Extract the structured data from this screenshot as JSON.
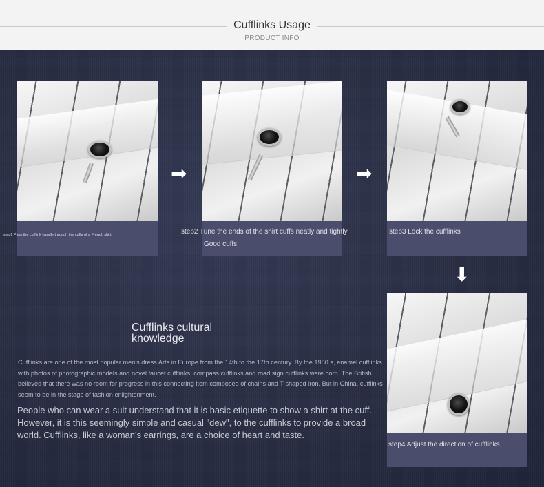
{
  "header": {
    "title": "Cufflinks Usage",
    "subtitle": "PRODUCT INFO"
  },
  "steps": [
    {
      "caption_lines": [
        "step1 Pass the cufflink handle through the cuffs of a French shirt"
      ]
    },
    {
      "caption_lines": [
        "step2 Tune the ends of the shirt cuffs neatly and tightly",
        "Good cuffs"
      ]
    },
    {
      "caption_lines": [
        "step3 Lock the cufflinks"
      ]
    },
    {
      "caption_lines": [
        "step4 Adjust the direction of cufflinks"
      ]
    }
  ],
  "arrows": {
    "right": "➡",
    "down": "⬇"
  },
  "culture": {
    "title_lines": [
      "Cufflinks cultural",
      "knowledge"
    ],
    "small_text": "Cufflinks are one of the most popular men's dress Arts in Europe from the 14th to the 17th century. By the 1950 s, enamel cufflinks with photos of photographic models and novel faucet cufflinks, compass cufflinks and road sign cufflinks were born. The British believed that there was no room for progress in this connecting item composed of chains and T-shaped iron. But in China, cufflinks seem to be in the stage of fashion enlightenment.",
    "big_text": "People who can wear a suit understand that it is basic etiquette to show a shirt at the cuff. However, it is this seemingly simple and casual \"dew\", to the cufflinks to provide a broad world. Cufflinks, like a woman's earrings, are a choice of heart and taste."
  },
  "colors": {
    "background": "#2b3046",
    "caption_panel": "#4a4e6c",
    "header_bg": "#f3f3f3"
  }
}
